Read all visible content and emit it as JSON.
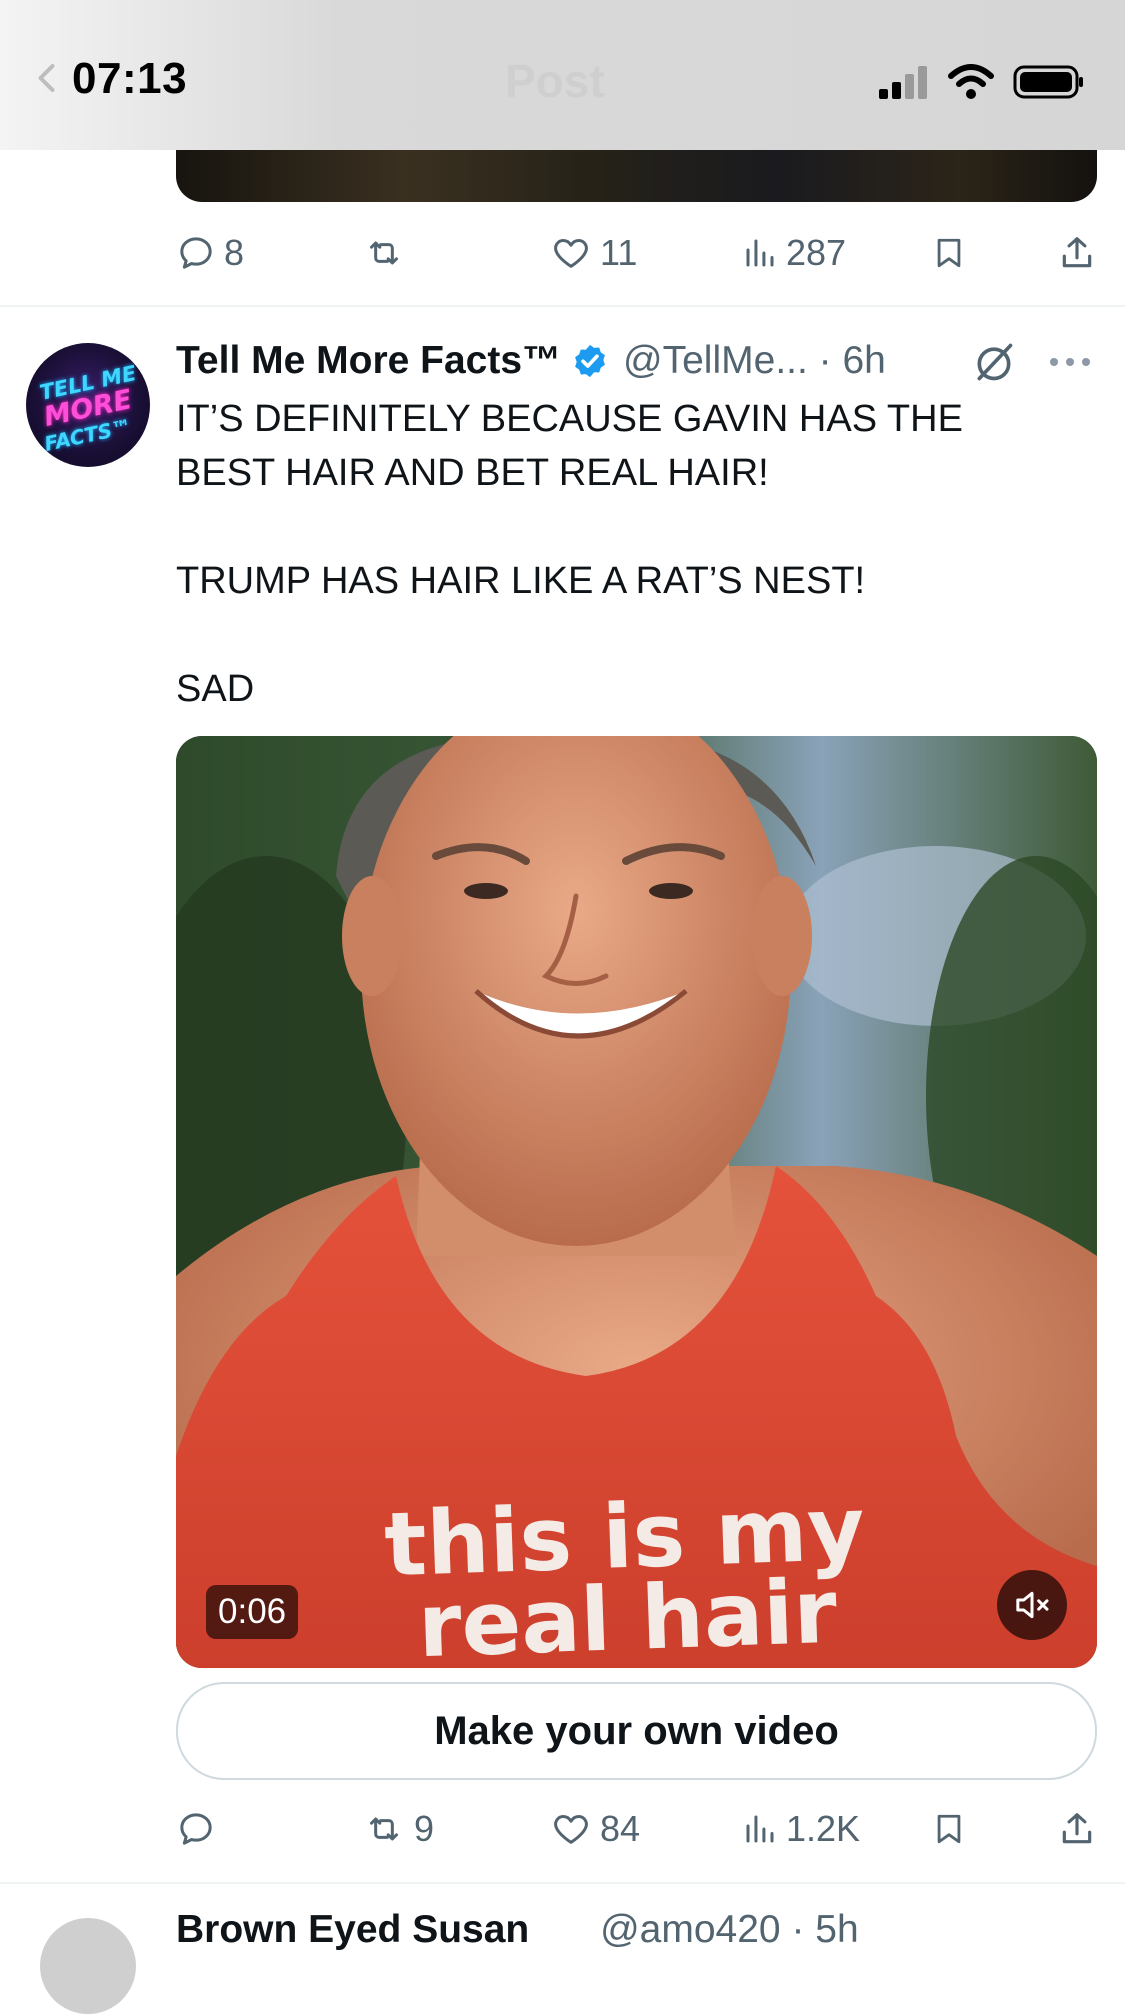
{
  "status_bar": {
    "time": "07:13"
  },
  "header": {
    "title": "Post"
  },
  "previous_post": {
    "actions": {
      "replies": "8",
      "reposts": "",
      "likes": "11",
      "views": "287"
    }
  },
  "post": {
    "author_name": "Tell Me More Facts™",
    "handle_time": "@TellMe... · 6h",
    "avatar_text": [
      "TELL ME",
      "MORE",
      "FACTS™"
    ],
    "text": [
      "IT’S DEFINITELY BECAUSE GAVIN HAS THE BEST HAIR AND BET REAL HAIR!",
      "TRUMP HAS HAIR LIKE A RAT’S NEST!",
      "SAD"
    ],
    "video": {
      "shirt_text_line1": "this is my",
      "shirt_text_line2": "real hair",
      "duration": "0:06"
    },
    "make_video_label": "Make your own video",
    "actions": {
      "replies": "",
      "reposts": "9",
      "likes": "84",
      "views": "1.2K"
    }
  },
  "next_post": {
    "author_name": "Brown Eyed Susan",
    "handle_time": "@amo420 · 5h"
  },
  "colors": {
    "verified": "#1d9bf0",
    "muted_text": "#536471",
    "text": "#0f1419"
  }
}
